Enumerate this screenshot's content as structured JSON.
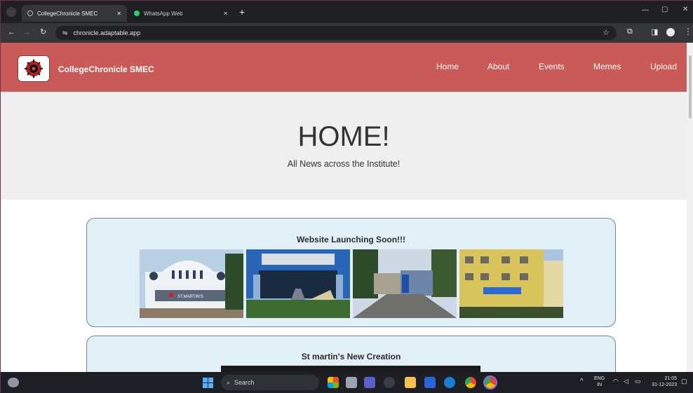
{
  "browser": {
    "tabs": [
      {
        "label": "CollegeChronicle SMEC",
        "active": true
      },
      {
        "label": "WhatsApp Web",
        "active": false
      }
    ],
    "url": "chronicle.adaptable.app"
  },
  "site": {
    "brand": "CollegeChronicle SMEC",
    "nav": [
      "Home",
      "About",
      "Events",
      "Memes",
      "Upload"
    ],
    "hero_title": "HOME!",
    "hero_subtitle": "All News across the Institute!",
    "cards": [
      {
        "title": "Website Launching Soon!!!"
      },
      {
        "title": "St martin's New Creation"
      }
    ],
    "photo_sign": "ST.MARTIN'S"
  },
  "taskbar": {
    "search_placeholder": "Search",
    "lang_top": "ENG",
    "lang_bottom": "IN",
    "time": "21:05",
    "date": "31-12-2023"
  },
  "colors": {
    "nav": "#c95a57",
    "card_bg": "#e0f0f6",
    "hero_bg": "#efefef"
  }
}
